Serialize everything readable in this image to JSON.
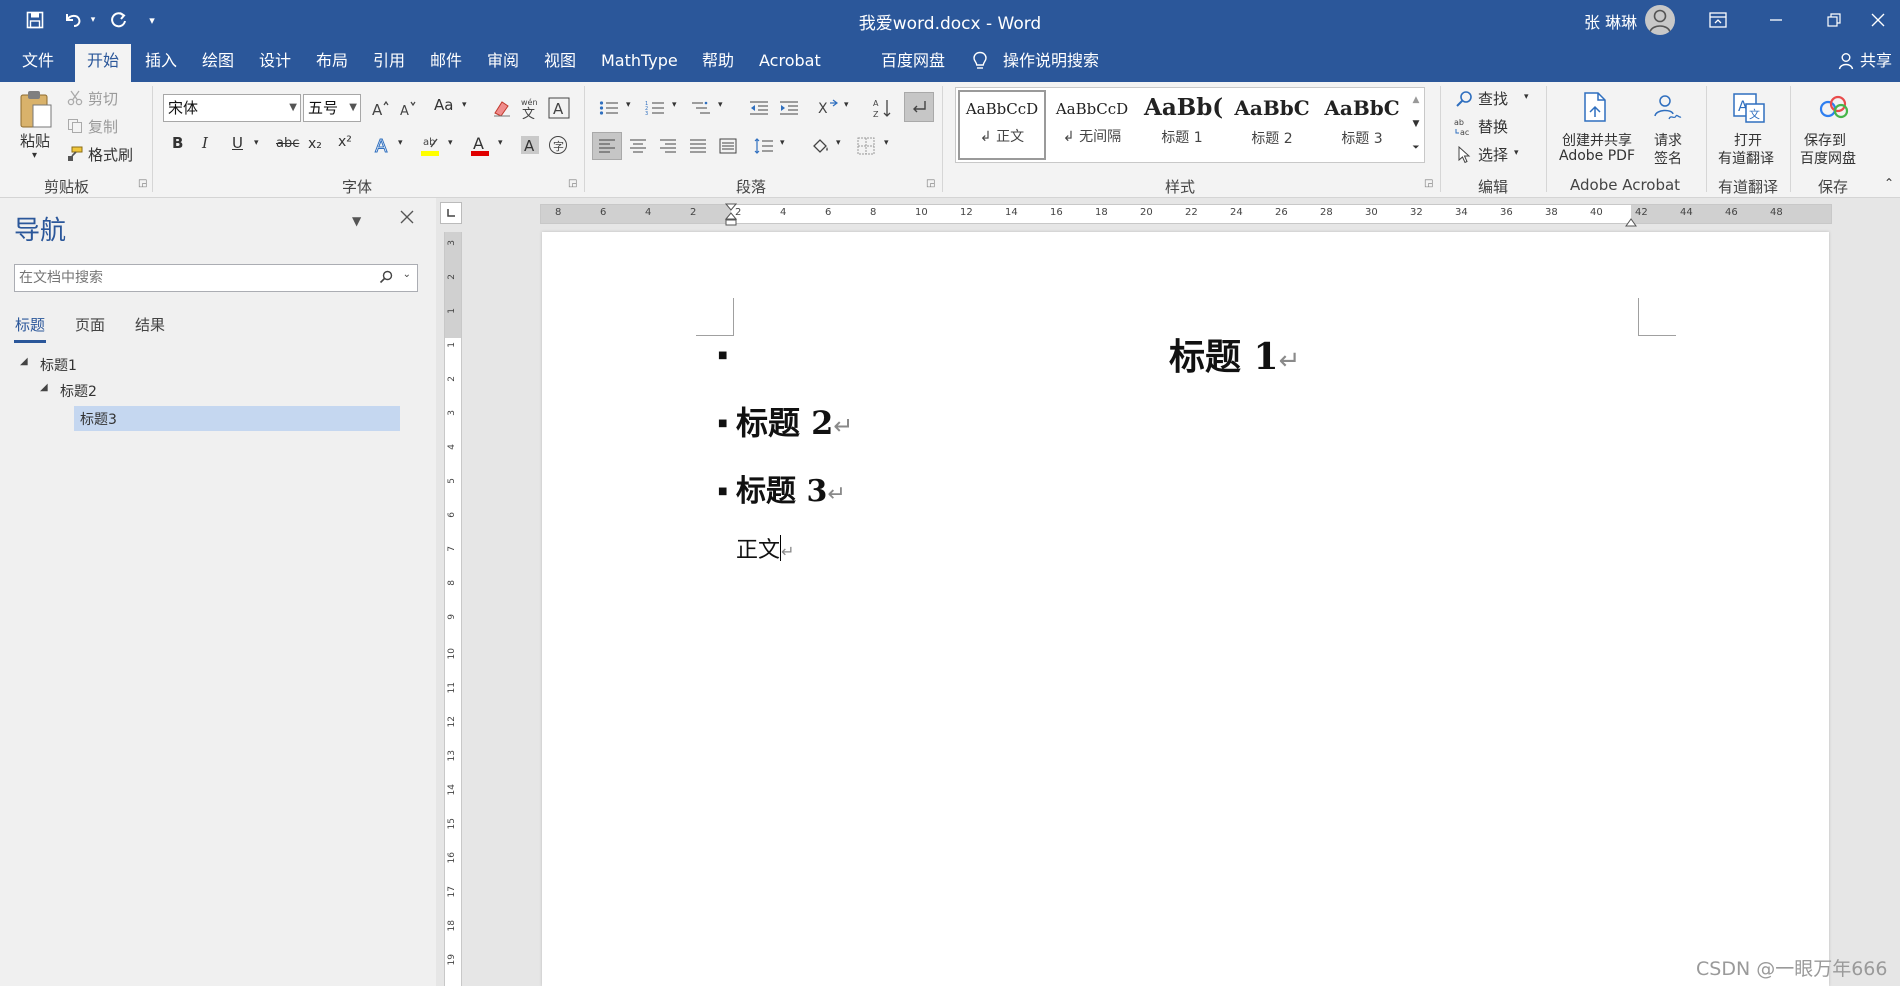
{
  "titlebar": {
    "title": "我爱word.docx  -  Word",
    "user": "张 琳琳",
    "colors": {
      "accent": "#2b579a",
      "ribbon": "#f3f3f3"
    }
  },
  "tabs": [
    "文件",
    "开始",
    "插入",
    "绘图",
    "设计",
    "布局",
    "引用",
    "邮件",
    "审阅",
    "视图",
    "MathType",
    "帮助",
    "Acrobat",
    "百度网盘",
    "操作说明搜索"
  ],
  "share_label": "共享",
  "clipboard": {
    "paste": "粘贴",
    "cut": "剪切",
    "copy": "复制",
    "format_painter": "格式刷",
    "group": "剪贴板"
  },
  "font": {
    "name": "宋体",
    "size": "五号",
    "bold": "B",
    "italic": "I",
    "underline": "U",
    "strike": "abc",
    "sub": "x₂",
    "sup": "x²",
    "grow": "A^",
    "shrink": "A˅",
    "case": "Aa",
    "group": "字体"
  },
  "paragraph": {
    "group": "段落"
  },
  "styles": {
    "items": [
      {
        "sample": "AaBbCcD",
        "name": "正文"
      },
      {
        "sample": "AaBbCcD",
        "name": "无间隔"
      },
      {
        "sample": "AaBb(",
        "name": "标题 1"
      },
      {
        "sample": "AaBbC",
        "name": "标题 2"
      },
      {
        "sample": "AaBbC",
        "name": "标题 3"
      }
    ],
    "group": "样式"
  },
  "editing": {
    "find": "查找",
    "replace": "替换",
    "select": "选择",
    "group": "编辑"
  },
  "acrobat": {
    "create": "创建并共享\nAdobe PDF",
    "create_l1": "创建并共享",
    "create_l2": "Adobe PDF",
    "sign_l1": "请求",
    "sign_l2": "签名",
    "group": "Adobe Acrobat"
  },
  "youdao": {
    "l1": "打开",
    "l2": "有道翻译",
    "group": "有道翻译"
  },
  "baidu": {
    "l1": "保存到",
    "l2": "百度网盘",
    "group": "保存"
  },
  "nav": {
    "title": "导航",
    "search_placeholder": "在文档中搜索",
    "tabs": [
      "标题",
      "页面",
      "结果"
    ],
    "tree": [
      "标题1",
      "标题2",
      "标题3"
    ]
  },
  "ruler_h": [
    "8",
    "6",
    "4",
    "2",
    "2",
    "4",
    "6",
    "8",
    "10",
    "12",
    "14",
    "16",
    "18",
    "20",
    "22",
    "24",
    "26",
    "28",
    "30",
    "32",
    "34",
    "36",
    "38",
    "40",
    "42",
    "44",
    "46",
    "48"
  ],
  "ruler_v": [
    "3",
    "2",
    "1",
    "1",
    "2",
    "3",
    "4",
    "5",
    "6",
    "7",
    "8",
    "9",
    "10",
    "11",
    "12",
    "13",
    "14",
    "15",
    "16",
    "17",
    "18",
    "19"
  ],
  "document": {
    "h1": "标题 1",
    "h2": "标题 2",
    "h3": "标题 3",
    "body": "正文"
  },
  "watermark": "CSDN @一眼万年666"
}
